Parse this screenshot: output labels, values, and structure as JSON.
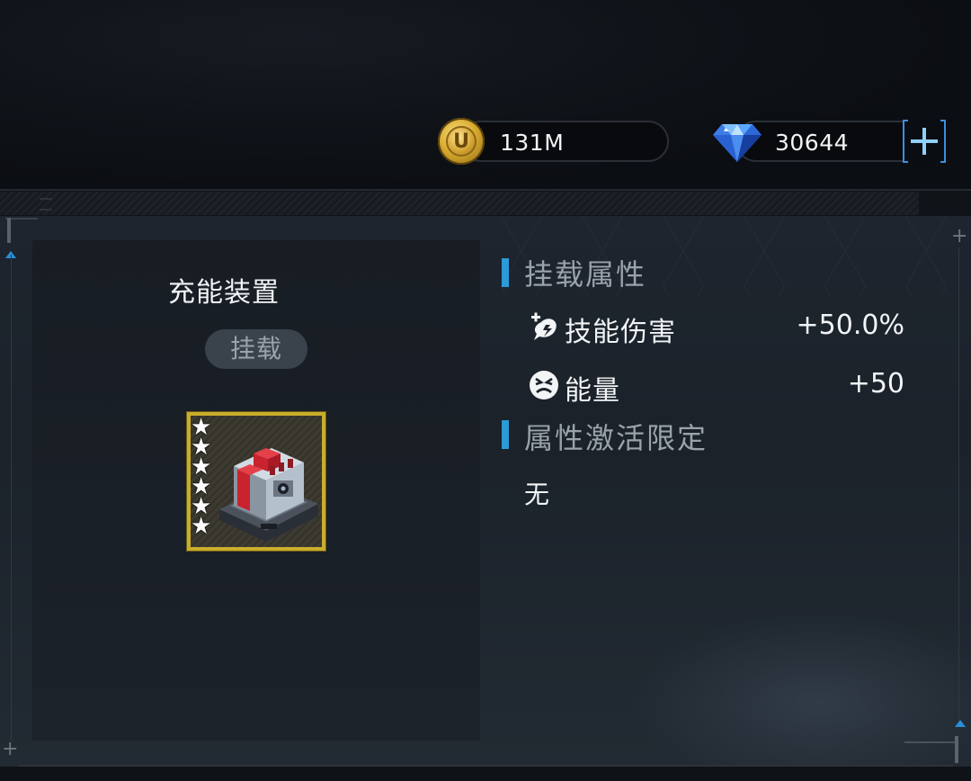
{
  "currency": {
    "gold": {
      "value": "131M",
      "icon": "gold-coin-icon",
      "coin_letter": "U"
    },
    "gems": {
      "value": "30644",
      "icon": "diamond-icon"
    },
    "add_button_icon": "plus-icon"
  },
  "item": {
    "name": "充能装置",
    "status_badge": "挂载",
    "stars": 6,
    "icon": "charging-device-icon",
    "frame_color": "#c9ad2c"
  },
  "sections": {
    "mount_attributes": {
      "title": "挂载属性",
      "rows": [
        {
          "icon": "skill-damage-icon",
          "label": "技能伤害",
          "value": "+50.0%"
        },
        {
          "icon": "energy-icon",
          "label": "能量",
          "value": "+50"
        }
      ]
    },
    "activation_limit": {
      "title": "属性激活限定",
      "value": "无"
    }
  },
  "colors": {
    "accent_blue": "#2c9ad6",
    "plus_button": "#3b8fe0"
  }
}
